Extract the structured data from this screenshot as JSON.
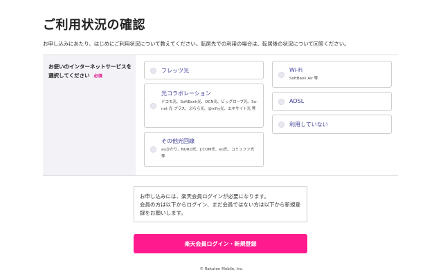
{
  "page": {
    "title": "ご利用状況の確認",
    "lead": "お申し込みにあたり、はじめにご利用状況について教えてください。転居先での利用の場合は、転居後の状況について回答ください。"
  },
  "question": {
    "label": "お使いのインターネットサービスを選択してください",
    "required": "必須"
  },
  "options": {
    "flets": {
      "title": "フレッツ光"
    },
    "collab": {
      "title": "光コラボレーション",
      "desc": "ドコモ光、SoftBank光、OCN光、ビッグローブ光、So-net 光 プラス、ぷらら光、@nifty光、エキサイト光 等"
    },
    "other": {
      "title": "その他光回線",
      "desc": "auひかり、NURO光、J:COM光、eo光、コミュファ光 等"
    },
    "wifi": {
      "title": "Wi-Fi",
      "desc": "SoftBank Air 等"
    },
    "adsl": {
      "title": "ADSL"
    },
    "none": {
      "title": "利用していない"
    }
  },
  "notice": {
    "line1": "お申し込みには、楽天会員ログインが必要になります。",
    "line2": "会員の方は以下からログイン、まだ会員ではない方は以下から新規登録をお願いします。"
  },
  "cta": {
    "label": "楽天会員ログイン・新規登録"
  },
  "footer": {
    "copyright": "© Rakuten Mobile, Inc."
  },
  "colors": {
    "accent": "#ff1b8d",
    "required": "#e4007f",
    "option_title": "#3c3c96",
    "label_bg": "#f2f2f7"
  }
}
